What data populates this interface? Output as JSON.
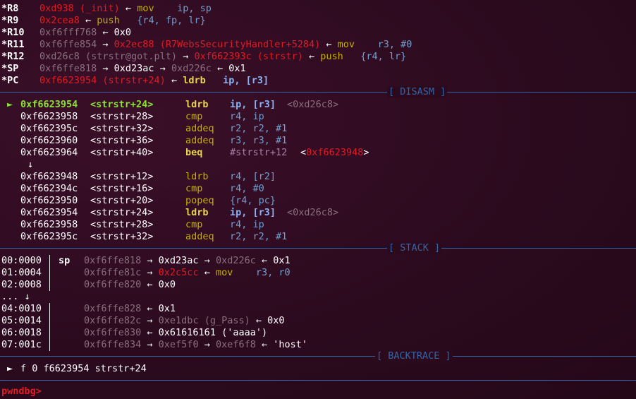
{
  "registers": [
    {
      "name": "*R8",
      "parts": [
        [
          "red",
          "0xd938 (_init)"
        ],
        [
          "w",
          " ← "
        ],
        [
          "yel",
          "mov    "
        ],
        [
          "blu",
          "ip, sp"
        ]
      ]
    },
    {
      "name": "*R9",
      "parts": [
        [
          "red",
          "0x2cea8"
        ],
        [
          "w",
          " ← "
        ],
        [
          "yel",
          "push   "
        ],
        [
          "blu",
          "{r4, fp, lr}"
        ]
      ]
    },
    {
      "name": "*R10",
      "parts": [
        [
          "gry",
          "0xf6fff768"
        ],
        [
          "w",
          " ← 0x0"
        ]
      ]
    },
    {
      "name": "*R11",
      "parts": [
        [
          "gry",
          "0xf6ffe854"
        ],
        [
          "w",
          " → "
        ],
        [
          "red",
          "0x2ec88 (R7WebsSecurityHandler+5284)"
        ],
        [
          "w",
          " ← "
        ],
        [
          "yel",
          "mov    "
        ],
        [
          "blu",
          "r3, #0"
        ]
      ]
    },
    {
      "name": "*R12",
      "parts": [
        [
          "gry",
          "0xd26c8 (strstr@got.plt)"
        ],
        [
          "w",
          " → "
        ],
        [
          "red",
          "0xf662393c (strstr)"
        ],
        [
          "w",
          " ← "
        ],
        [
          "yel",
          "push   "
        ],
        [
          "blu",
          "{r4, lr}"
        ]
      ]
    },
    {
      "name": "*SP",
      "parts": [
        [
          "gry",
          "0xf6ffe818"
        ],
        [
          "w",
          " → 0xd23ac → "
        ],
        [
          "gry",
          "0xd226c"
        ],
        [
          "w",
          " ← 0x1"
        ]
      ]
    },
    {
      "name": "*PC",
      "parts": [
        [
          "red",
          "0xf6623954 (strstr+24)"
        ],
        [
          "w",
          " ← "
        ],
        [
          "ylb",
          "ldrb   "
        ],
        [
          "blb",
          "ip, [r3]"
        ]
      ]
    }
  ],
  "sections": {
    "disasm": "[ DISASM ]",
    "stack": "[ STACK ]",
    "backtrace": "[ BACKTRACE ]"
  },
  "disasm": [
    {
      "marker": "►",
      "addr": "0xf6623954",
      "sym": "<strstr+24>",
      "mnem": "ldrb",
      "ops": "ip, [r3]",
      "extra": "<0xd26c8>",
      "current": true
    },
    {
      "marker": "",
      "addr": "0xf6623958",
      "sym": "<strstr+28>",
      "mnem": "cmp",
      "ops": "r4, ip",
      "extra": ""
    },
    {
      "marker": "",
      "addr": "0xf662395c",
      "sym": "<strstr+32>",
      "mnem": "addeq",
      "ops": "r2, r2, #1",
      "extra": ""
    },
    {
      "marker": "",
      "addr": "0xf6623960",
      "sym": "<strstr+36>",
      "mnem": "addeq",
      "ops": "r3, r3, #1",
      "extra": ""
    },
    {
      "marker": "",
      "addr": "0xf6623964",
      "sym": "<strstr+40>",
      "mnem": "beq",
      "ops": "#strstr+12",
      "extra": "<0xf6623948>",
      "branch": true
    },
    {
      "arrow": "↓"
    },
    {
      "marker": "",
      "addr": "0xf6623948",
      "sym": "<strstr+12>",
      "mnem": "ldrb",
      "ops": "r4, [r2]",
      "extra": ""
    },
    {
      "marker": "",
      "addr": "0xf662394c",
      "sym": "<strstr+16>",
      "mnem": "cmp",
      "ops": "r4, #0",
      "extra": ""
    },
    {
      "marker": "",
      "addr": "0xf6623950",
      "sym": "<strstr+20>",
      "mnem": "popeq",
      "ops": "{r4, pc}",
      "extra": ""
    },
    {
      "marker": "",
      "addr": "0xf6623954",
      "sym": "<strstr+24>",
      "mnem": "ldrb",
      "ops": "ip, [r3]",
      "extra": "<0xd26c8>",
      "bold": true
    },
    {
      "marker": "",
      "addr": "0xf6623958",
      "sym": "<strstr+28>",
      "mnem": "cmp",
      "ops": "r4, ip",
      "extra": ""
    },
    {
      "marker": "",
      "addr": "0xf662395c",
      "sym": "<strstr+32>",
      "mnem": "addeq",
      "ops": "r2, r2, #1",
      "extra": ""
    }
  ],
  "stack": [
    {
      "idx": "00:0000",
      "reg": "sp",
      "parts": [
        [
          "gry",
          "0xf6ffe818"
        ],
        [
          "w",
          " → 0xd23ac → "
        ],
        [
          "gry",
          "0xd226c"
        ],
        [
          "w",
          " ← 0x1"
        ]
      ]
    },
    {
      "idx": "01:0004",
      "reg": "",
      "parts": [
        [
          "gry",
          "0xf6ffe81c"
        ],
        [
          "w",
          " → "
        ],
        [
          "red",
          "0x2c5cc"
        ],
        [
          "w",
          " ← "
        ],
        [
          "yel",
          "mov    "
        ],
        [
          "blu",
          "r3, r0"
        ]
      ]
    },
    {
      "idx": "02:0008",
      "reg": "",
      "parts": [
        [
          "gry",
          "0xf6ffe820"
        ],
        [
          "w",
          " ← 0x0"
        ]
      ]
    },
    {
      "idx": "... ↓",
      "reg": "",
      "parts": [],
      "skip": true
    },
    {
      "idx": "04:0010",
      "reg": "",
      "parts": [
        [
          "gry",
          "0xf6ffe828"
        ],
        [
          "w",
          " ← 0x1"
        ]
      ]
    },
    {
      "idx": "05:0014",
      "reg": "",
      "parts": [
        [
          "gry",
          "0xf6ffe82c"
        ],
        [
          "w",
          " → "
        ],
        [
          "gry",
          "0xe1dbc (g_Pass)"
        ],
        [
          "w",
          " ← 0x0"
        ]
      ]
    },
    {
      "idx": "06:0018",
      "reg": "",
      "parts": [
        [
          "gry",
          "0xf6ffe830"
        ],
        [
          "w",
          " ← 0x61616161 ('aaaa')"
        ]
      ]
    },
    {
      "idx": "07:001c",
      "reg": "",
      "parts": [
        [
          "gry",
          "0xf6ffe834"
        ],
        [
          "w",
          " → "
        ],
        [
          "gry",
          "0xef5f0"
        ],
        [
          "w",
          " → "
        ],
        [
          "gry",
          "0xef6f8"
        ],
        [
          "w",
          " ← 'host'"
        ]
      ]
    }
  ],
  "backtrace": [
    {
      "marker": "►",
      "text": "f 0 f6623954 strstr+24"
    }
  ],
  "prompt": "pwndbg>"
}
